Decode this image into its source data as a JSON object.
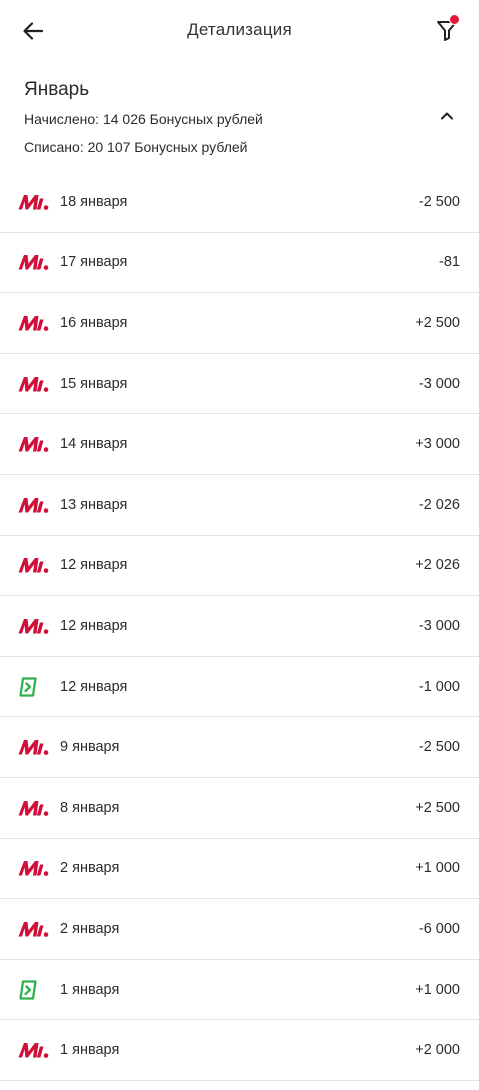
{
  "header": {
    "title": "Детализация",
    "back_icon": "arrow-left-icon",
    "filter_icon": "filter-icon",
    "filter_dot_color": "#e3173e"
  },
  "month": {
    "title": "Январь",
    "accrued": "Начислено: 14 026 Бонусных рублей",
    "spent": "Списано: 20 107 Бонусных рублей",
    "collapse_icon": "chevron-up-icon"
  },
  "colors": {
    "brand_red": "#d0103a",
    "green": "#2fb24c",
    "divider": "#e3e3e3"
  },
  "transactions": [
    {
      "icon": "m-logo-icon",
      "date": "18 января",
      "amount": "-2 500"
    },
    {
      "icon": "m-logo-icon",
      "date": "17 января",
      "amount": "-81"
    },
    {
      "icon": "m-logo-icon",
      "date": "16 января",
      "amount": "+2 500"
    },
    {
      "icon": "m-logo-icon",
      "date": "15 января",
      "amount": "-3 000"
    },
    {
      "icon": "m-logo-icon",
      "date": "14 января",
      "amount": "+3 000"
    },
    {
      "icon": "m-logo-icon",
      "date": "13 января",
      "amount": "-2 026"
    },
    {
      "icon": "m-logo-icon",
      "date": "12 января",
      "amount": "+2 026"
    },
    {
      "icon": "m-logo-icon",
      "date": "12 января",
      "amount": "-3 000"
    },
    {
      "icon": "green-card-icon",
      "date": "12 января",
      "amount": "-1 000"
    },
    {
      "icon": "m-logo-icon",
      "date": "9 января",
      "amount": "-2 500"
    },
    {
      "icon": "m-logo-icon",
      "date": "8 января",
      "amount": "+2 500"
    },
    {
      "icon": "m-logo-icon",
      "date": "2 января",
      "amount": "+1 000"
    },
    {
      "icon": "m-logo-icon",
      "date": "2 января",
      "amount": "-6 000"
    },
    {
      "icon": "green-card-icon",
      "date": "1 января",
      "amount": "+1 000"
    },
    {
      "icon": "m-logo-icon",
      "date": "1 января",
      "amount": "+2 000"
    }
  ]
}
